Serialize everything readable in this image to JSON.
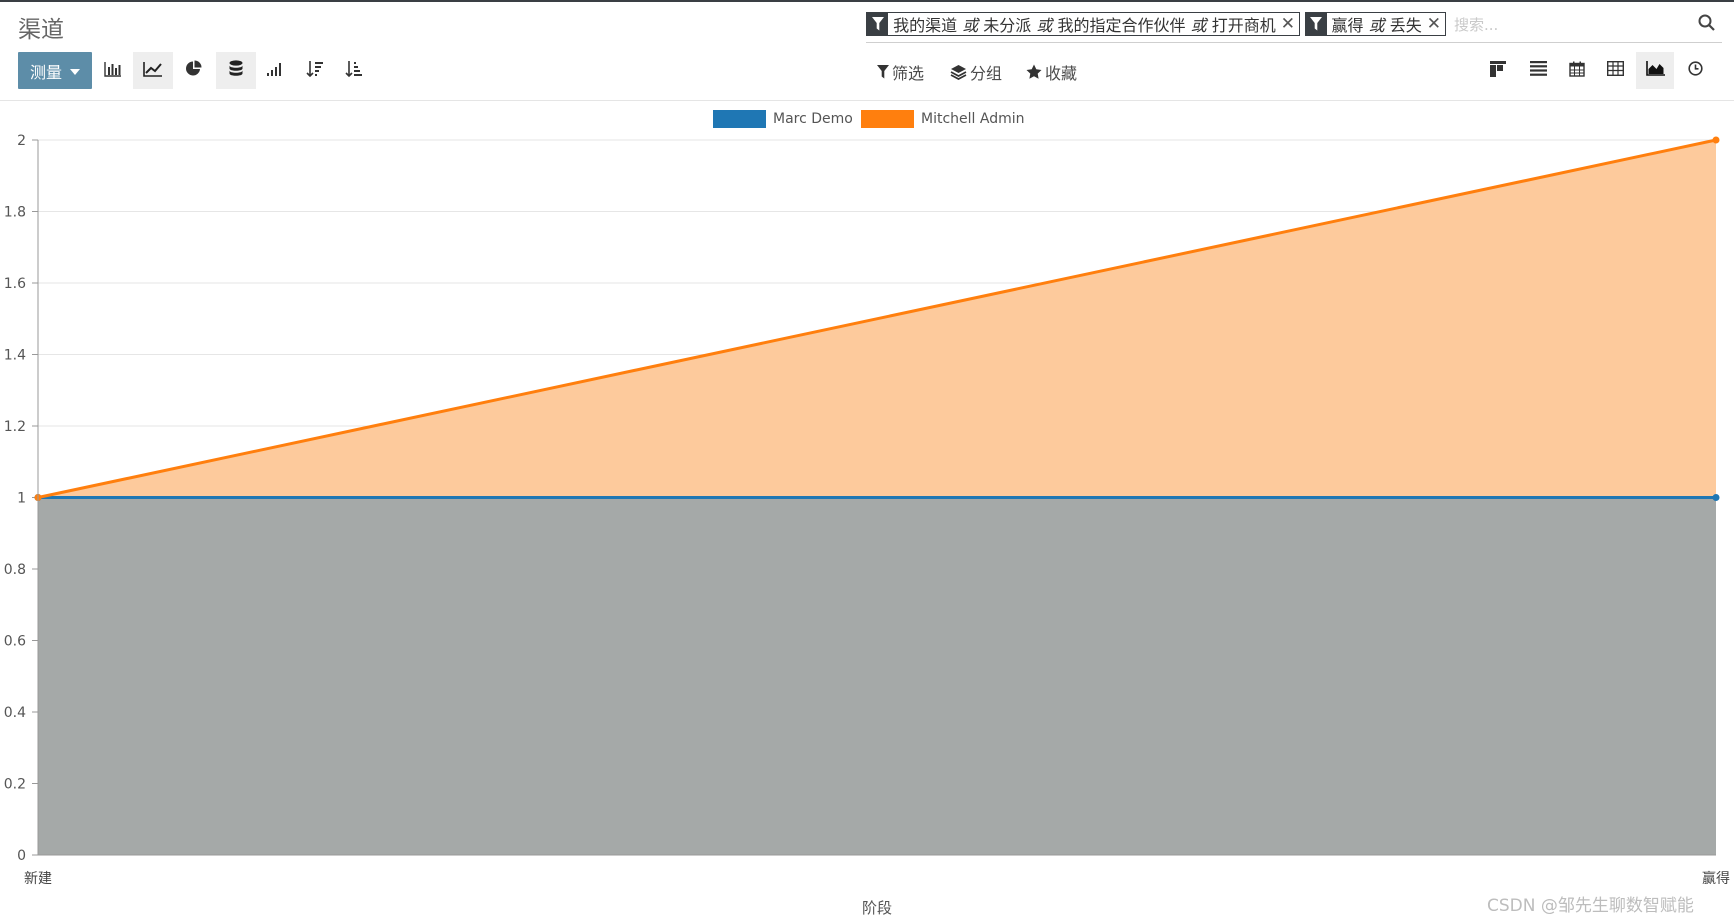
{
  "header": {
    "title": "渠道"
  },
  "search": {
    "placeholder": "搜索...",
    "facets": [
      {
        "parts": [
          "我的渠道",
          "或",
          "未分派",
          "或",
          "我的指定合作伙伴",
          "或",
          "打开商机"
        ]
      },
      {
        "parts": [
          "赢得",
          "或",
          "丢失"
        ]
      }
    ]
  },
  "toolbar": {
    "measure_label": "测量",
    "filters_label": "筛选",
    "groupby_label": "分组",
    "favorites_label": "收藏"
  },
  "chart_data": {
    "type": "area",
    "stacked": true,
    "categories": [
      "新建",
      "赢得"
    ],
    "series": [
      {
        "name": "Marc Demo",
        "values": [
          1,
          1
        ],
        "color": "#1f77b4",
        "fill": "#a5a9a8"
      },
      {
        "name": "Mitchell Admin",
        "values": [
          0,
          1
        ],
        "color": "#ff7f0e",
        "fill": "#fdca9c"
      }
    ],
    "xlabel": "阶段",
    "ylabel": "",
    "ylim": [
      0,
      2
    ],
    "yticks": [
      0,
      0.2,
      0.4,
      0.6,
      0.8,
      1,
      1.2,
      1.4,
      1.6,
      1.8,
      2
    ],
    "grid": true,
    "legend": "top"
  },
  "watermark": "CSDN @邹先生聊数智赋能"
}
